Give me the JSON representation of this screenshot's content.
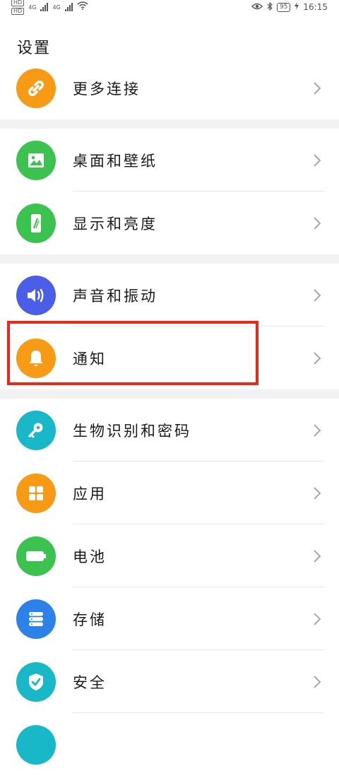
{
  "status_bar": {
    "hd1": "HD",
    "hd2": "HD",
    "signal1": "4G",
    "signal2": "4G",
    "battery": "95",
    "time": "16:15"
  },
  "page": {
    "title": "设置"
  },
  "groups": [
    {
      "items": [
        {
          "label": "更多连接",
          "icon": "link-icon",
          "color": "#f79a16"
        }
      ]
    },
    {
      "items": [
        {
          "label": "桌面和壁纸",
          "icon": "image-icon",
          "color": "#3cc24f"
        },
        {
          "label": "显示和亮度",
          "icon": "phone-brightness-icon",
          "color": "#3cc24f"
        }
      ]
    },
    {
      "items": [
        {
          "label": "声音和振动",
          "icon": "speaker-icon",
          "color": "#4a5ee6"
        },
        {
          "label": "通知",
          "icon": "bell-icon",
          "color": "#f79a16"
        }
      ]
    },
    {
      "items": [
        {
          "label": "生物识别和密码",
          "icon": "key-icon",
          "color": "#19b8c8"
        },
        {
          "label": "应用",
          "icon": "apps-grid-icon",
          "color": "#f79a16"
        },
        {
          "label": "电池",
          "icon": "battery-icon",
          "color": "#3cc24f"
        },
        {
          "label": "存储",
          "icon": "storage-icon",
          "color": "#2c82e8"
        },
        {
          "label": "安全",
          "icon": "shield-check-icon",
          "color": "#19b8c8"
        }
      ]
    }
  ],
  "highlight_color": "#e8281b"
}
